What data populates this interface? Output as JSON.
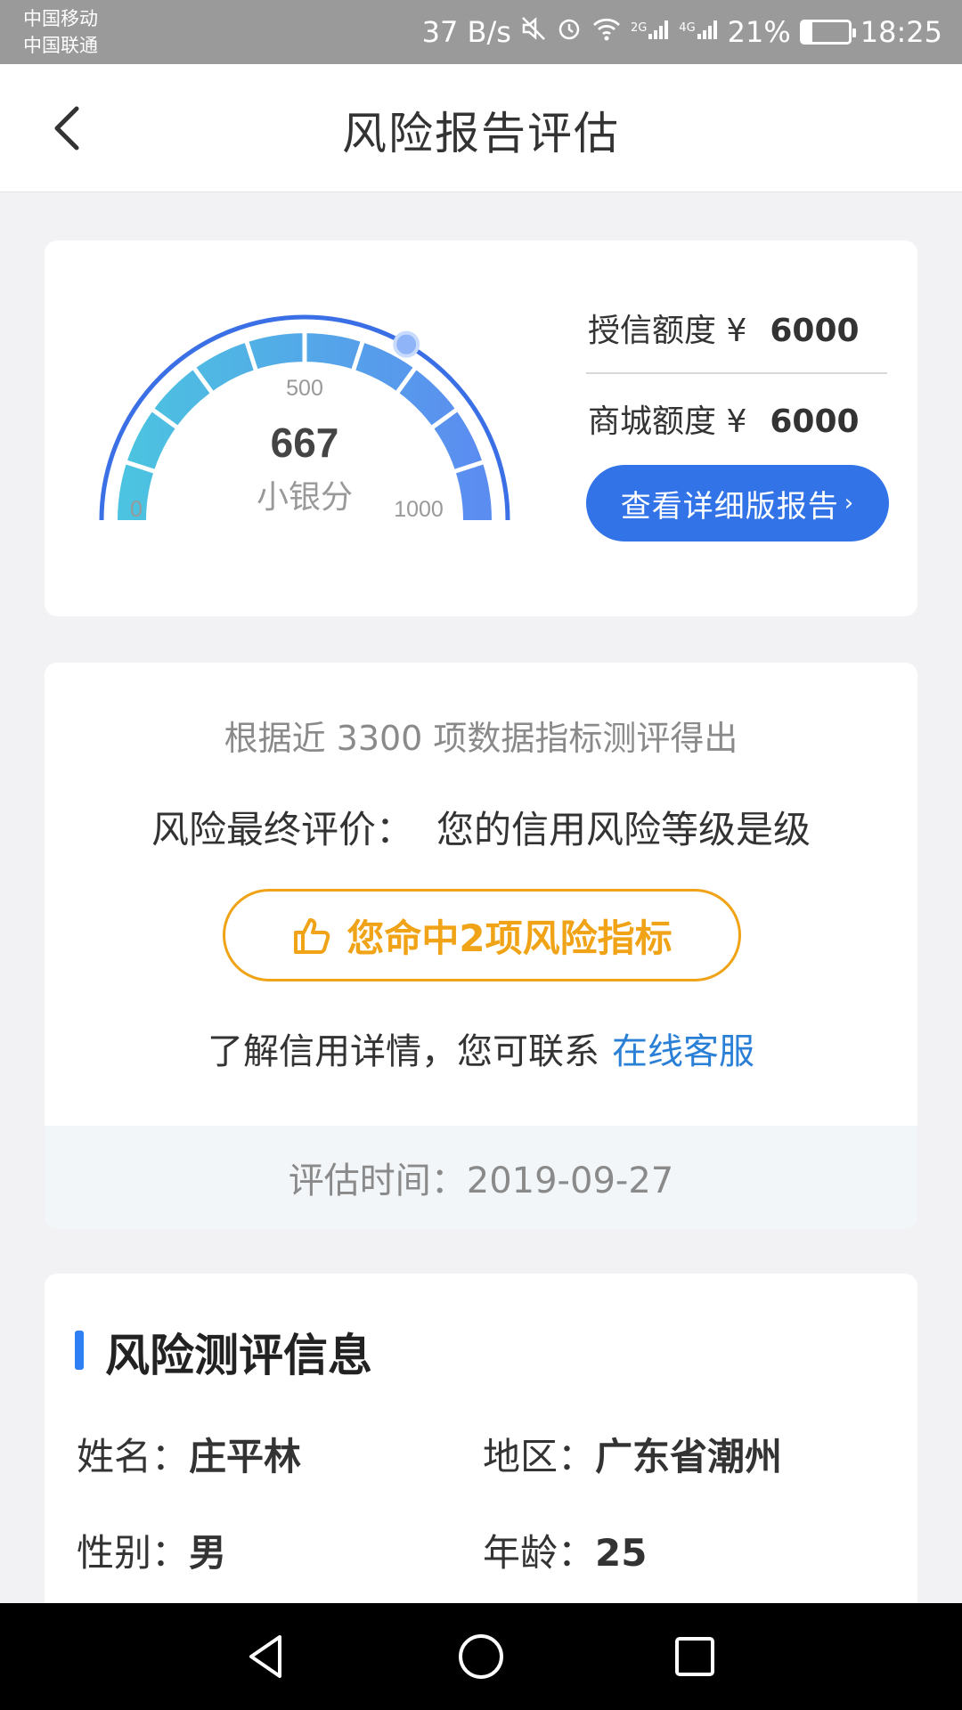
{
  "status_bar": {
    "carrier_1": "中国移动",
    "carrier_2": "中国联通",
    "net_speed": "37 B/s",
    "sig_2g": "2G",
    "sig_4g": "4G",
    "battery": "21%",
    "battery_level": 0.21,
    "time": "18:25",
    "icons": [
      "mute-icon",
      "alarm-icon",
      "wifi-icon",
      "signal-2g-icon",
      "signal-4g-icon",
      "battery-icon"
    ]
  },
  "header": {
    "title": "风险报告评估",
    "back_icon": "chevron-left-icon"
  },
  "score_card": {
    "gauge": {
      "score": "667",
      "score_label": "小银分",
      "tick_min": "0",
      "tick_mid": "500",
      "tick_max": "1000",
      "value": 667,
      "min": 0,
      "max": 1000
    },
    "credit_label": "授信额度 ¥",
    "credit_value": "6000",
    "mall_label": "商城额度 ¥",
    "mall_value": "6000",
    "report_button": "查看详细版报告",
    "report_chevron": "›"
  },
  "evaluation": {
    "basis_text": "根据近 3300 项数据指标测评得出",
    "final_label": "风险最终评价：",
    "final_text": "您的信用风险等级是级",
    "risk_pill": "您命中2项风险指标",
    "risk_icon": "thumbs-up-icon",
    "contact_text": "了解信用详情，您可联系",
    "contact_link": "在线客服",
    "eval_time": "评估时间：2019-09-27"
  },
  "info": {
    "section_title": "风险测评信息",
    "name_label": "姓名：",
    "name_value": "庄平林",
    "region_label": "地区：",
    "region_value": "广东省潮州",
    "gender_label": "性别：",
    "gender_value": "男",
    "age_label": "年龄：",
    "age_value": "25"
  },
  "nav": {
    "back_icon": "nav-back-icon",
    "home_icon": "nav-home-icon",
    "recent_icon": "nav-recent-icon"
  },
  "colors": {
    "primary": "#3273e8",
    "warning": "#f0a316",
    "link": "#2a7fd6",
    "gauge_start": "#4cc3e0",
    "gauge_end": "#5b8df0"
  }
}
